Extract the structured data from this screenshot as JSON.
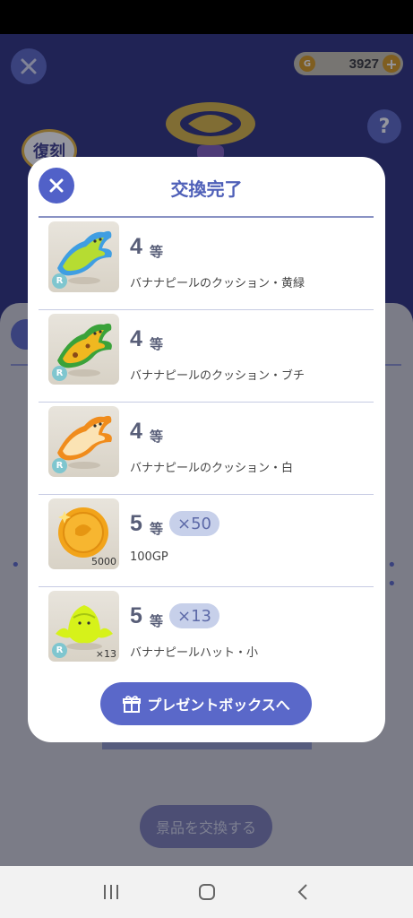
{
  "header": {
    "coin_icon_text": "G",
    "coins": "3927",
    "coin_plus": "+",
    "help": "?",
    "badge": "復刻"
  },
  "modal": {
    "title": "交換完了",
    "prizes": [
      {
        "rank": "4",
        "unit": "等",
        "multiplier": "",
        "name": "バナナピールのクッション・黄緑",
        "rarity": "R",
        "qty": "",
        "icon": "banana-peel-cushion-yellowgreen-icon"
      },
      {
        "rank": "4",
        "unit": "等",
        "multiplier": "",
        "name": "バナナピールのクッション・ブチ",
        "rarity": "R",
        "qty": "",
        "icon": "banana-peel-cushion-spotted-icon"
      },
      {
        "rank": "4",
        "unit": "等",
        "multiplier": "",
        "name": "バナナピールのクッション・白",
        "rarity": "R",
        "qty": "",
        "icon": "banana-peel-cushion-white-icon"
      },
      {
        "rank": "5",
        "unit": "等",
        "multiplier": "×50",
        "name": "100GP",
        "rarity": "",
        "qty": "5000",
        "icon": "gold-coin-icon"
      },
      {
        "rank": "5",
        "unit": "等",
        "multiplier": "×13",
        "name": "バナナピールハット・小",
        "rarity": "R",
        "qty": "×13",
        "icon": "banana-peel-hat-icon"
      }
    ],
    "present_button": "プレゼントボックスへ"
  },
  "background": {
    "exchange_button": "景品を交換する"
  },
  "colors": {
    "accent": "#5161c8",
    "modal_bg": "#ffffff",
    "game_bg": "#2a2f7a"
  }
}
